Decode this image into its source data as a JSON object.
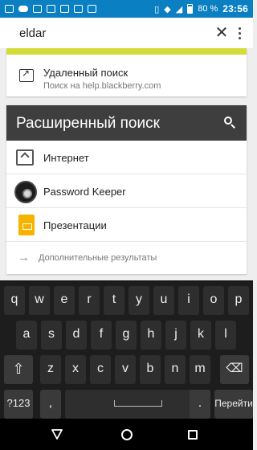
{
  "status_bar": {
    "battery": "80 %",
    "time": "23:56"
  },
  "search": {
    "query": "eldar"
  },
  "remote_search": {
    "title": "Удаленный поиск",
    "subtitle": "Поиск на help.blackberry.com"
  },
  "advanced_search": {
    "title": "Расширенный поиск",
    "items": [
      {
        "label": "Интернет",
        "icon": "internet-icon"
      },
      {
        "label": "Password Keeper",
        "icon": "password-keeper-icon"
      },
      {
        "label": "Презентации",
        "icon": "slides-icon"
      }
    ],
    "more_results": "Дополнительные результаты"
  },
  "keyboard": {
    "row1": [
      "q",
      "w",
      "e",
      "r",
      "t",
      "y",
      "u",
      "i",
      "o",
      "p"
    ],
    "row2": [
      "a",
      "s",
      "d",
      "f",
      "g",
      "h",
      "j",
      "k",
      "l"
    ],
    "row3": [
      "z",
      "x",
      "c",
      "v",
      "b",
      "n",
      "m"
    ],
    "symbols_label": "?123",
    "comma": ",",
    "period": ".",
    "go_label": "Перейти"
  },
  "colors": {
    "status_bar": "#0a7fc2",
    "accent_yellow": "#d4dc3a",
    "header_dark": "#3e3e3e",
    "slides": "#f4b400"
  }
}
